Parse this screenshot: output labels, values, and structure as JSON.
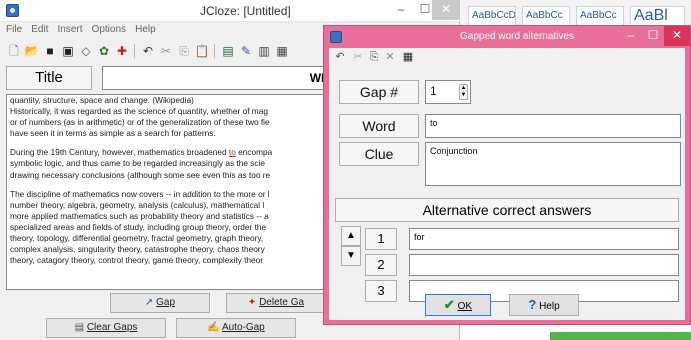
{
  "main": {
    "window_title": "JCloze: [Untitled]",
    "menu": [
      "File",
      "Edit",
      "Insert",
      "Options",
      "Help"
    ],
    "title_button": "Title",
    "title_value": "WHAT IS MATHEMATI",
    "body_lines": [
      "quantity, structure, space and change. (Wikipedia)",
      "Historically, it was regarded as the science of quantity, whether of mag",
      "or of numbers (as in arithmetic) or of the generalization of these two fie",
      "have seen it in terms as simple as a search for patterns.",
      "",
      "During the 19th Century, however, mathematics broadened ",
      "to",
      " encompa",
      "symbolic logic, and thus came to be regarded increasingly as the scie",
      "drawing necessary conclusions (although some see even this as too re",
      "",
      "The discipline of mathematics now covers -- in addition to the more or l",
      "number theory, algebra, geometry, analysis (calculus), mathematical l",
      "more applied mathematics such as probability theory and statistics -- a",
      "specialized areas and fields of study, including group theory, order the",
      "theory, topology, differential geometry, fractal geometry, graph theory,",
      "complex analysis, singularity theory, catastrophe theory, chaos theory",
      "theory, catagory theory, control theory, game theory, complexity theor"
    ],
    "buttons": {
      "gap_prefix": "",
      "gap_label": "Gap",
      "delete_label": "Delete Ga",
      "clear_label": "Clear Gaps",
      "autogap_label": "Auto-Gap"
    }
  },
  "dialog": {
    "title": "Gapped word alternatives",
    "gap_label": "Gap #",
    "gap_value": "1",
    "word_label": "Word",
    "word_value": "to",
    "clue_label": "Clue",
    "clue_value": "Conjunction",
    "alt_heading": "Alternative correct answers",
    "alternatives": [
      {
        "num": "1",
        "value": "for"
      },
      {
        "num": "2",
        "value": ""
      },
      {
        "num": "3",
        "value": ""
      }
    ],
    "ok_label": "OK",
    "help_label": "Help"
  },
  "background": {
    "style_chips": [
      "AaBbCcDc",
      "AaBbCc",
      "AaBbCc",
      "AaBl"
    ]
  },
  "colors": {
    "dialog_frame": "#e86f9a",
    "gap_text": "#d02020",
    "ok_border": "#2d7be0"
  }
}
